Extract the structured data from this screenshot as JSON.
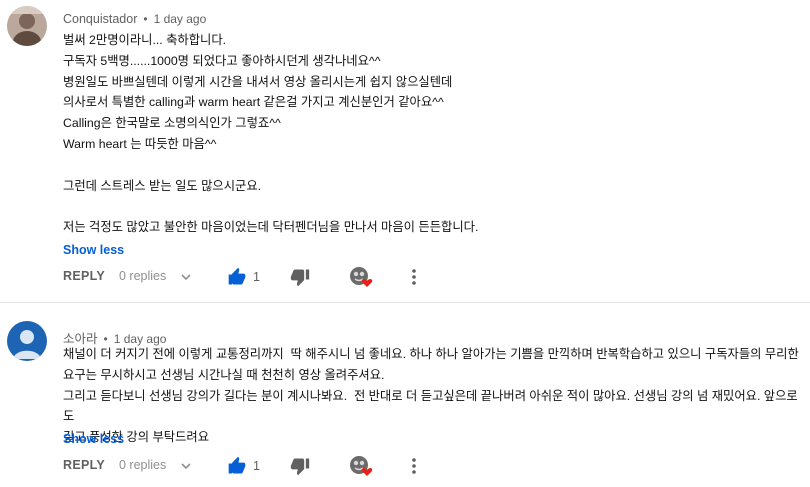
{
  "comments": [
    {
      "author": "Conquistador",
      "time": "1 day ago",
      "lines": [
        "벌써 2만명이라니... 축하합니다.",
        "구독자 5백명......1000명 되었다고 좋아하시던게 생각나네요^^",
        "병원일도 바쁘실텐데 이렇게 시간을 내셔서 영상 올리시는게 쉽지 않으실텐데",
        "의사로서 특별한 calling과 warm heart 같은걸 가지고 계신분인거 같아요^^",
        "Calling은 한국말로 소명의식인가 그렇죠^^",
        "Warm heart 는 따듯한 마음^^",
        "",
        "그런데 스트레스 받는 일도 많으시군요.",
        "",
        "저는 걱정도 많았고 불안한 마음이었는데 닥터펜더님을 만나서 마음이 든든합니다."
      ],
      "show_less": "Show less",
      "reply": "REPLY",
      "replies": "0 replies",
      "likes": "1",
      "avatar_color": "#9c8a7e"
    },
    {
      "author": "소아라",
      "time": "1 day ago",
      "lines": [
        "채널이 더 커지기 전에 이렇게 교통정리까지  딱 해주시니 넘 좋네요. 하나 하나 알아가는 기쁨을 만끽하며 반복학습하고 있으니 구독자들의 무리한",
        "요구는 무시하시고 선생님 시간나실 때 천천히 영상 올려주셔요.",
        "그리고 듣다보니 선생님 강의가 길다는 분이 계시나봐요.  전 반대로 더 듣고싶은데 끝나버려 아쉬운 적이 많아요. 선생님 강의 넘 재밌어요. 앞으로도",
        "길고 풍성한 강의 부탁드려요"
      ],
      "show_less": "Show less",
      "reply": "REPLY",
      "replies": "0 replies",
      "likes": "1",
      "avatar_color": "#1e64b4"
    }
  ],
  "colors": {
    "like_blue": "#065fd4",
    "heart_red": "#e62117",
    "link_blue": "#065fd4"
  },
  "icons": {
    "like": "thumbs-up-icon",
    "dislike": "thumbs-down-icon",
    "heart": "creator-heart-icon",
    "more": "more-vert-icon",
    "chevron": "chevron-down-icon"
  }
}
